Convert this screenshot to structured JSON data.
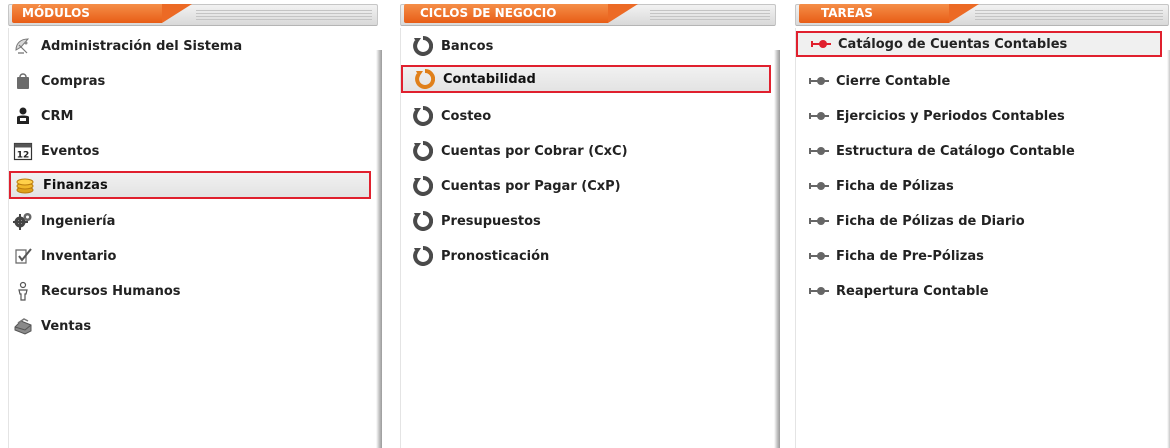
{
  "modulos": {
    "title": "MÓDULOS",
    "items": [
      {
        "label": "Administración del Sistema",
        "icon": "satellite-dish-icon",
        "selected": false
      },
      {
        "label": "Compras",
        "icon": "shopping-bag-icon",
        "selected": false
      },
      {
        "label": "CRM",
        "icon": "person-icon",
        "selected": false
      },
      {
        "label": "Eventos",
        "icon": "calendar-icon",
        "icon_text": "12",
        "selected": false
      },
      {
        "label": "Finanzas",
        "icon": "coins-icon",
        "selected": true
      },
      {
        "label": "Ingeniería",
        "icon": "gears-icon",
        "selected": false
      },
      {
        "label": "Inventario",
        "icon": "checklist-icon",
        "selected": false
      },
      {
        "label": "Recursos Humanos",
        "icon": "human-figure-icon",
        "selected": false
      },
      {
        "label": "Ventas",
        "icon": "cash-register-icon",
        "selected": false
      }
    ]
  },
  "ciclos": {
    "title": "CICLOS DE NEGOCIO",
    "items": [
      {
        "label": "Bancos",
        "icon": "cycle-icon",
        "selected": false
      },
      {
        "label": "Contabilidad",
        "icon": "cycle-icon",
        "selected": true
      },
      {
        "label": "Costeo",
        "icon": "cycle-icon",
        "selected": false
      },
      {
        "label": "Cuentas por Cobrar (CxC)",
        "icon": "cycle-icon",
        "selected": false
      },
      {
        "label": "Cuentas por Pagar (CxP)",
        "icon": "cycle-icon",
        "selected": false
      },
      {
        "label": "Presupuestos",
        "icon": "cycle-icon",
        "selected": false
      },
      {
        "label": "Pronosticación",
        "icon": "cycle-icon",
        "selected": false
      }
    ]
  },
  "tareas": {
    "title": "TAREAS",
    "items": [
      {
        "label": "Catálogo de Cuentas Contables",
        "icon": "pin-icon",
        "selected": true
      },
      {
        "label": "Cierre Contable",
        "icon": "pin-icon",
        "selected": false
      },
      {
        "label": "Ejercicios y Periodos Contables",
        "icon": "pin-icon",
        "selected": false
      },
      {
        "label": "Estructura de Catálogo Contable",
        "icon": "pin-icon",
        "selected": false
      },
      {
        "label": "Ficha de Pólizas",
        "icon": "pin-icon",
        "selected": false
      },
      {
        "label": "Ficha de Pólizas de Diario",
        "icon": "pin-icon",
        "selected": false
      },
      {
        "label": "Ficha de Pre-Pólizas",
        "icon": "pin-icon",
        "selected": false
      },
      {
        "label": "Reapertura Contable",
        "icon": "pin-icon",
        "selected": false
      }
    ]
  },
  "colors": {
    "accent_orange": "#e85d16",
    "selection_border": "#e0202e",
    "selected_pin": "#e0202e",
    "pin_gray": "#666666",
    "cycle_gray": "#555555",
    "cycle_orange": "#e0801a"
  }
}
